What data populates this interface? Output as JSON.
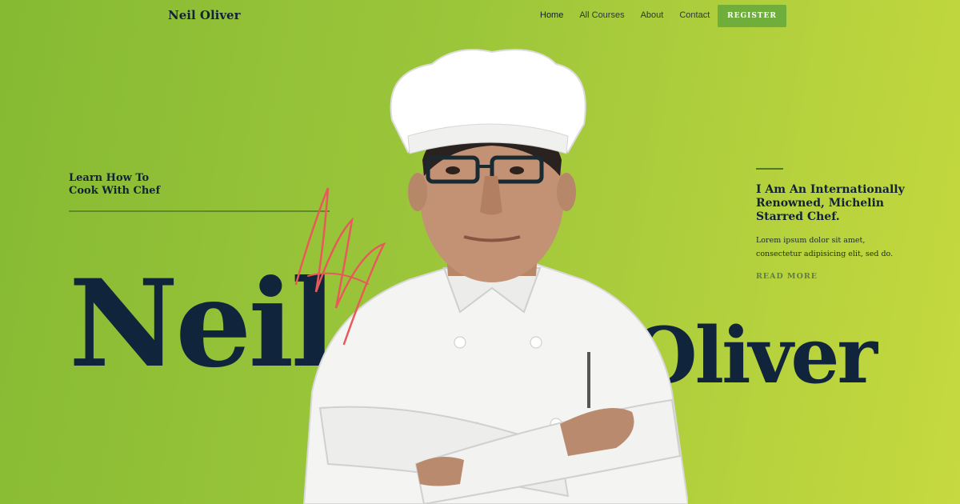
{
  "nav": {
    "logo": "Neil Oliver",
    "items": [
      "Home",
      "All Courses",
      "About",
      "Contact"
    ],
    "register": "REGISTER"
  },
  "hero": {
    "tagline_line1": "Learn How To",
    "tagline_line2": "Cook With Chef",
    "first_name": "Neil",
    "last_name": "Oliver",
    "heading_line1": "I Am An Internationally",
    "heading_line2": "Renowned, Michelin",
    "heading_line3": "Starred Chef.",
    "body_line1": "Lorem ipsum dolor sit amet,",
    "body_line2": "consectetur adipisicing elit, sed do.",
    "read_more": "READ MORE"
  },
  "colors": {
    "bg_left": "#86ba33",
    "bg_right": "#c6d93f",
    "navy": "#10243c",
    "register": "#6fae3a",
    "signature": "#e85a5a"
  }
}
